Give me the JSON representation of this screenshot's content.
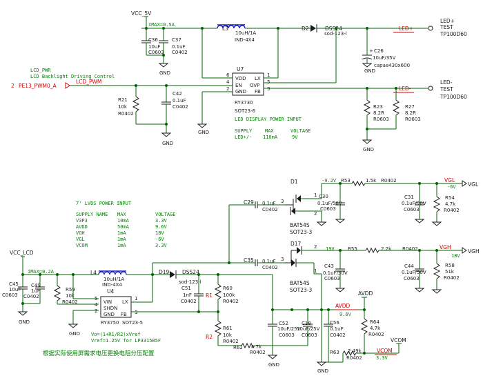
{
  "top": {
    "vcc_5v": "VCC_5V",
    "imax_top": "IMAX=0.5A",
    "c36": {
      "ref": "C36",
      "val": "10uF",
      "pkg": "C0603"
    },
    "c37": {
      "ref": "C37",
      "val": "0.1uF",
      "pkg": "C0402"
    },
    "gnd": "GND",
    "l3": {
      "ref": "L3",
      "val": "10uH/1A",
      "pkg": "IND-4X4"
    },
    "d2": {
      "ref": "D2",
      "val": "DSS24",
      "pkg": "sod-123-l"
    },
    "led_plus_net": "LED+",
    "led_plus_test": [
      "LED+",
      "TEST",
      "TP100D60"
    ],
    "c26": {
      "ref": "C26",
      "val": "10uF/35V",
      "pkg": "capae430x600"
    },
    "lcd_pwr": "LCD_PWR",
    "lcd_backlight": "LCD Backlight Driving Control",
    "pin2": "2",
    "pe13": "PE13_PWM0_A",
    "lcd_pwm": "LCD_PWM",
    "u7": {
      "ref": "U7",
      "part": "RY3730",
      "pkg": "SOT23-6"
    },
    "u7_pins": {
      "vdd": "VDD",
      "lx": "LX",
      "en": "EN",
      "ovp": "OVP",
      "gnd": "GND",
      "fb": "FB",
      "p6": "6",
      "p4": "4",
      "p2": "2",
      "p1": "1",
      "p5": "5",
      "p3": "3"
    },
    "r21": {
      "ref": "R21",
      "val": "10k",
      "pkg": "R0402"
    },
    "c42": {
      "ref": "C42",
      "val": "0.1uF",
      "pkg": "C0402"
    },
    "led_minus_net": "LED-",
    "led_minus_test": [
      "LED-",
      "TEST",
      "TP100D60"
    ],
    "r23": {
      "ref": "R23",
      "val": "8.2R",
      "pkg": "R0603"
    },
    "r27": {
      "ref": "R27",
      "val": "8.2R",
      "pkg": "R0603"
    },
    "led_display": "LED DISPLAY POWER INPUT",
    "led_table": {
      "h1": "SUPPLY",
      "h2": "MAX",
      "h3": "VOLTAGE",
      "c1": "LED+/-",
      "c2": "110mA",
      "c3": "9V"
    }
  },
  "bottom": {
    "lvds_title": "7' LVDS POWER INPUT",
    "table_headers": [
      "SUPPLY NAME",
      "MAX",
      "VOLTAGE"
    ],
    "table_rows": [
      [
        "V3P3",
        "10mA",
        "3.3V"
      ],
      [
        "AVDD",
        "50mA",
        "9.6V"
      ],
      [
        "VGH",
        "1mA",
        "18V"
      ],
      [
        "VGL",
        "1mA",
        "-6V"
      ],
      [
        "VCOM",
        "1mA",
        "3.3V"
      ]
    ],
    "vcc_lcd": "VCC_LCD",
    "imax_bot": "IMAX=0.2A",
    "c45": {
      "ref": "C45",
      "val": "10uF",
      "pkg": "C0603"
    },
    "c49": {
      "ref": "C49",
      "val": "1uF",
      "pkg": "C0402"
    },
    "r59": {
      "ref": "R59",
      "val": "10k",
      "pkg": "R0402"
    },
    "l4": {
      "ref": "L4",
      "val": "10uH/1A",
      "pkg": "IND-4X4"
    },
    "u4": {
      "ref": "U4",
      "part": "RY3750",
      "pkg": "SOT23-5"
    },
    "u4_pins": {
      "vin": "VIN",
      "lx": "LX",
      "shdn": "SHDN",
      "gnd": "GND",
      "fb": "FB",
      "p5": "5",
      "p4": "4",
      "p2": "2",
      "p1": "1",
      "p3": "3"
    },
    "d19": {
      "ref": "D19",
      "val": "DSS24",
      "pkg": "sod-123-l"
    },
    "c51": {
      "ref": "C51",
      "val": "1nF",
      "pkg": "C0402"
    },
    "r60": {
      "ref": "R60",
      "val": "100k",
      "pkg": "R0402"
    },
    "r1": "R1",
    "r2": "R2",
    "r61": {
      "ref": "R61",
      "val": "10k",
      "pkg": "R0402"
    },
    "r62": {
      "ref": "R62",
      "val": "4.7k",
      "pkg": "R0402"
    },
    "formula1": "Vo=(1+R1/R2)xVref",
    "formula2": "Vref=1.25V for LP3315B5F",
    "note": "根据实际使用屏需求电压更换电阻分压配置",
    "c29": {
      "ref": "C29",
      "val": "0.1uF",
      "pkg": "C0402"
    },
    "c35": {
      "ref": "C35",
      "val": "0.1uF",
      "pkg": "C0402"
    },
    "d1": {
      "ref": "D1",
      "pkg": "BAT54S",
      "pkg2": "SOT23-3"
    },
    "d17": {
      "ref": "D17",
      "pkg": "BAT54S",
      "pkg2": "SOT23-3"
    },
    "vgl_net": "-9.2V",
    "r53": {
      "ref": "R53",
      "val": "1.5k",
      "pkg": "R0402"
    },
    "vgl": "VGL",
    "vgl_val": "-6V",
    "c30": {
      "ref": "C30",
      "val": "0.1uF/50V",
      "pkg": "C0603"
    },
    "c31": {
      "ref": "C31",
      "val": "0.1uF/50V",
      "pkg": "C0603"
    },
    "r54": {
      "ref": "R54",
      "val": "4.7k",
      "pkg": "R0402"
    },
    "vgh_net": "19V",
    "r55": {
      "ref": "R55",
      "val": "2.2k",
      "pkg": "R0402"
    },
    "vgh": "VGH",
    "vgh_val": "18V",
    "c43": {
      "ref": "C43",
      "val": "0.1uF/50V",
      "pkg": "C0603"
    },
    "c44": {
      "ref": "C44",
      "val": "0.1uF/50V",
      "pkg": "C0603"
    },
    "r58": {
      "ref": "R58",
      "val": "51k",
      "pkg": "R0402"
    },
    "avdd": "AVDD",
    "avdd_val": "9.6V",
    "avdd_lbl": "AVDD",
    "c52": {
      "ref": "C52",
      "val": "10uF/25V",
      "pkg": "C0603"
    },
    "c18": {
      "ref": "C18",
      "val": "10uF/25V",
      "pkg": "C0603"
    },
    "c56": {
      "ref": "C56",
      "val": "0.1uF",
      "pkg": "C0402"
    },
    "r64": {
      "ref": "R64",
      "val": "4.7k",
      "pkg": "R0402"
    },
    "r63": {
      "ref": "R63",
      "val": "2.49k",
      "pkg": "R0402"
    },
    "vcom": "VCOM",
    "vcom_net": "VCOM",
    "vcom_val": "3.3V"
  }
}
